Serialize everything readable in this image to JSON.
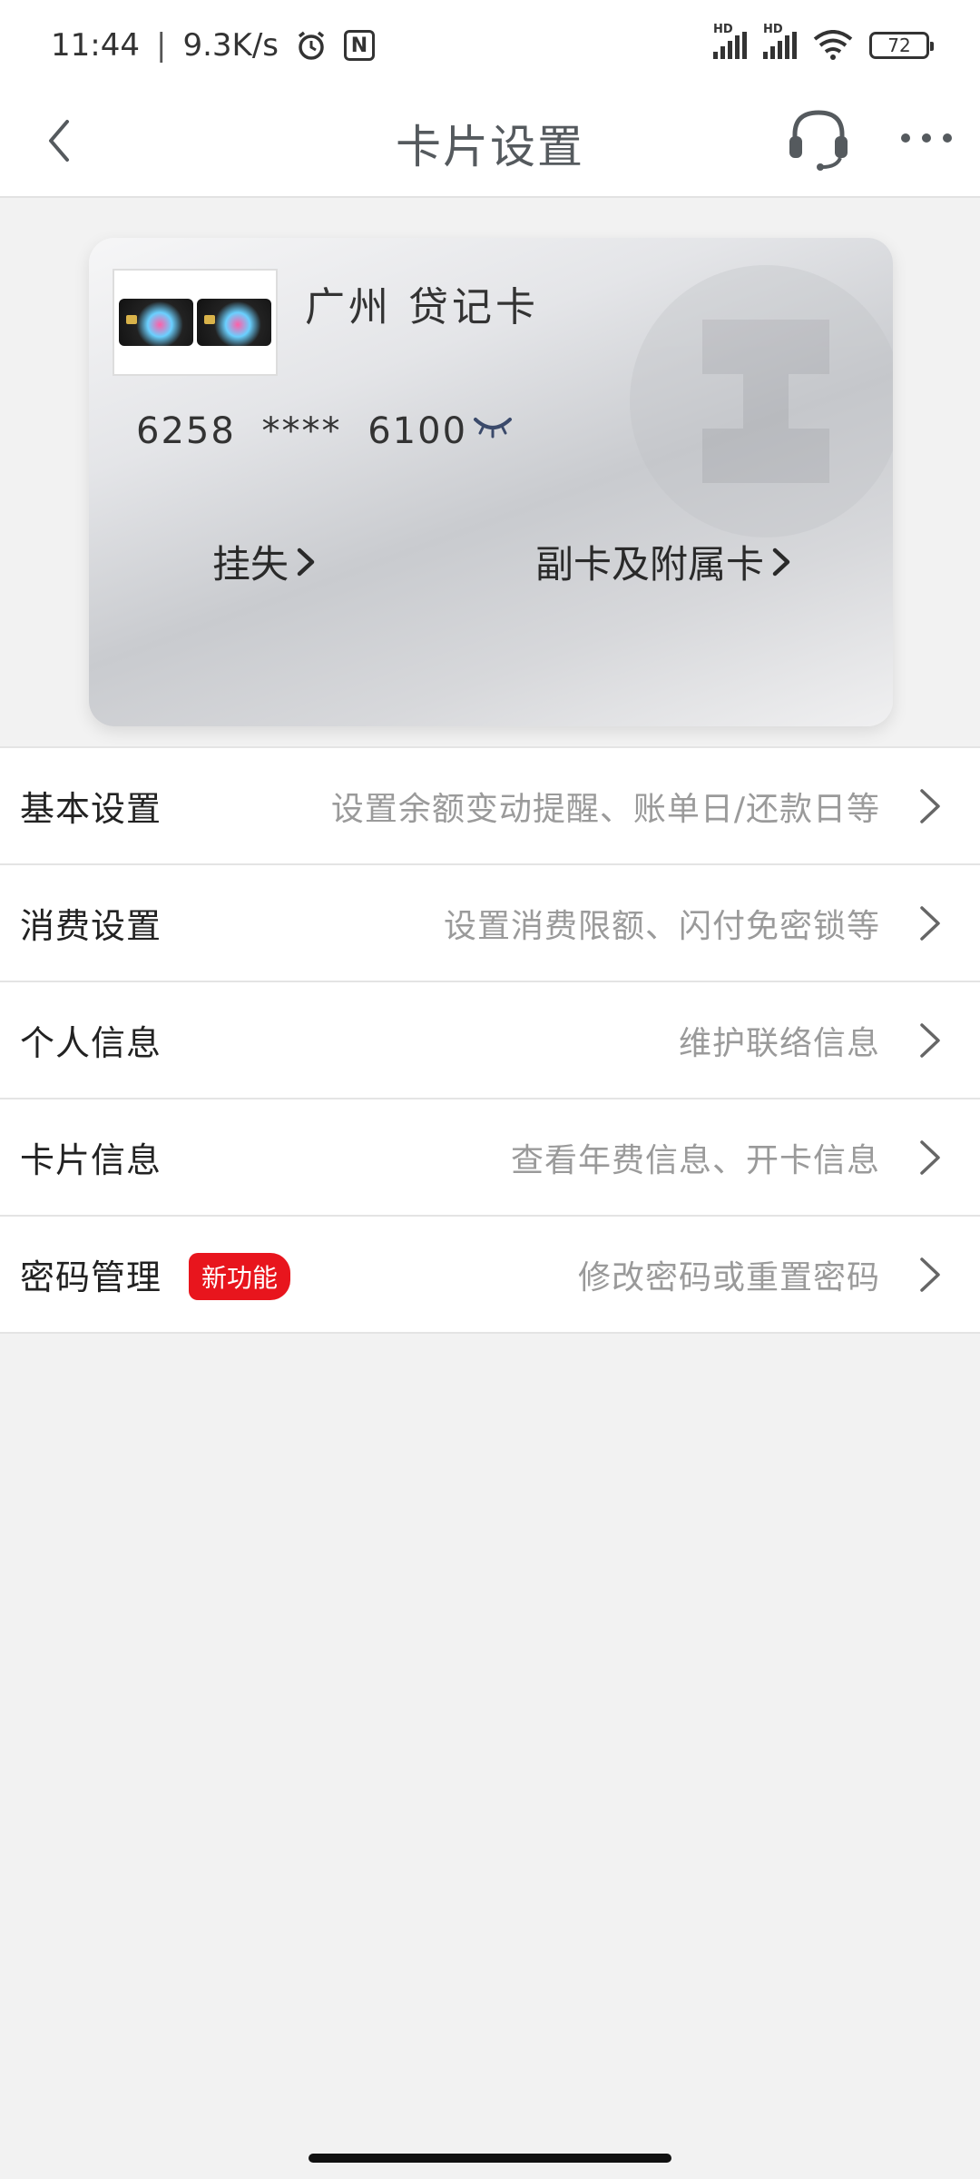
{
  "status_bar": {
    "time": "11:44",
    "separator": "|",
    "net_speed": "9.3K/s",
    "hd1": "HD",
    "hd2": "HD",
    "battery": "72"
  },
  "header": {
    "title": "卡片设置"
  },
  "card": {
    "name": "广州  贷记卡",
    "number": "6258 **** 6100",
    "report_loss": "挂失",
    "sub_cards": "副卡及附属卡"
  },
  "settings": {
    "rows": [
      {
        "label": "基本设置",
        "desc": "设置余额变动提醒、账单日/还款日等"
      },
      {
        "label": "消费设置",
        "desc": "设置消费限额、闪付免密锁等"
      },
      {
        "label": "个人信息",
        "desc": "维护联络信息"
      },
      {
        "label": "卡片信息",
        "desc": "查看年费信息、开卡信息"
      },
      {
        "label": "密码管理",
        "desc": "修改密码或重置密码",
        "badge": "新功能"
      }
    ]
  },
  "colors": {
    "accent_red": "#e8151d",
    "header_title": "#555a5e",
    "desc_gray": "#9a9a9a"
  },
  "icons": {
    "back": "chevron-left-icon",
    "service": "headset-icon",
    "more": "more-dots-icon",
    "eye": "eye-closed-icon",
    "row_arrow": "chevron-right-icon"
  }
}
